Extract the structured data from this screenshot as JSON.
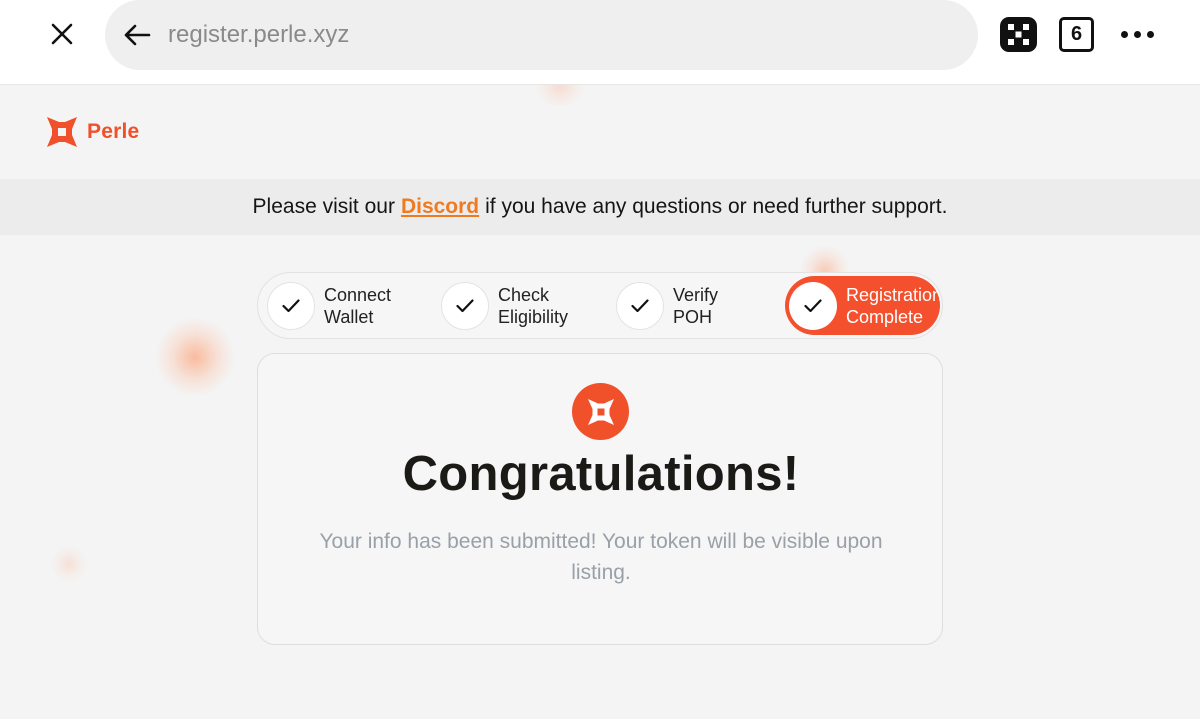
{
  "browser": {
    "url": "register.perle.xyz",
    "tab_count": "6",
    "icons": {
      "close": "close-icon",
      "back": "arrow-left-icon",
      "extension": "okx-wallet-icon",
      "menu": "more-horizontal-icon"
    }
  },
  "brand": {
    "name": "Perle",
    "color": "#f0502a"
  },
  "notice": {
    "before": "Please visit our",
    "link": "Discord",
    "after": "if you have any questions or need further support.",
    "link_color": "#f07a20"
  },
  "steps": [
    {
      "line1": "Connect",
      "line2": "Wallet",
      "status": "done"
    },
    {
      "line1": "Check",
      "line2": "Eligibility",
      "status": "done"
    },
    {
      "line1": "Verify",
      "line2": "POH",
      "status": "done"
    },
    {
      "line1": "Registration",
      "line2": "Complete",
      "status": "active"
    }
  ],
  "card": {
    "title": "Congratulations!",
    "message": "Your info has been submitted! Your token will be visible upon listing."
  }
}
